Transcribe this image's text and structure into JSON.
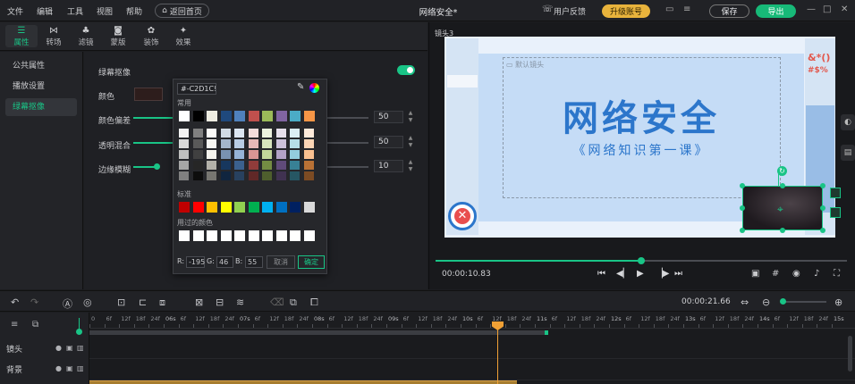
{
  "menubar": {
    "menus": [
      "文件",
      "编辑",
      "工具",
      "视图",
      "帮助"
    ],
    "home_button": "返回首页",
    "document_title": "网络安全*",
    "feedback": "用户反馈",
    "upgrade": "升级账号",
    "save": "保存",
    "export": "导出"
  },
  "tabs": [
    {
      "label": "属性",
      "icon": "sliders-icon",
      "active": true
    },
    {
      "label": "转场",
      "icon": "transition-icon"
    },
    {
      "label": "滤镜",
      "icon": "filter-icon"
    },
    {
      "label": "蒙版",
      "icon": "mask-icon"
    },
    {
      "label": "装饰",
      "icon": "decoration-icon"
    },
    {
      "label": "效果",
      "icon": "sparkle-icon"
    }
  ],
  "sidebar": {
    "items": [
      {
        "label": "公共属性"
      },
      {
        "label": "播放设置"
      },
      {
        "label": "绿幕抠像",
        "active": true
      }
    ]
  },
  "props": {
    "section_label": "绿幕抠像",
    "color_label": "颜色",
    "hue_label": "颜色偏差",
    "blend_label": "透明混合",
    "edge_label": "边缘模糊",
    "hue_value": "50",
    "blend_value": "50",
    "edge_value": "10",
    "enabled": true,
    "key_color": "#2d1d1c"
  },
  "picker": {
    "hex": "#-C2D1C!",
    "common_label": "常用",
    "standard_label": "标准",
    "recent_label": "用过的颜色",
    "r_label": "R:",
    "g_label": "G:",
    "b_label": "B:",
    "r": "-195",
    "g": "46",
    "b": "55",
    "cancel": "取消",
    "ok": "确定",
    "common_colors": [
      "#ffffff",
      "#000000",
      "#eeece1",
      "#1f497d",
      "#4f81bd",
      "#c0504d",
      "#9bbb59",
      "#8064a2",
      "#4bacc6",
      "#f79646"
    ],
    "standard_colors": [
      "#c00000",
      "#ff0000",
      "#ffc000",
      "#ffff00",
      "#92d050",
      "#00b050",
      "#00b0f0",
      "#0070c0",
      "#002060",
      "#d9d9d9"
    ],
    "recent_colors": [
      "#ffffff",
      "#ffffff",
      "#ffffff",
      "#ffffff",
      "#ffffff",
      "#ffffff",
      "#ffffff",
      "#ffffff",
      "#ffffff",
      "#ffffff"
    ]
  },
  "preview": {
    "camera_label": "镜头3",
    "default_camera": "默认镜头",
    "title_text": "网络安全",
    "subtitle_text": "《网络知识第一课》",
    "current_time": "00:00:10.83",
    "progress": 0.5
  },
  "timeline": {
    "duration": "00:00:21.66",
    "ruler_labels": [
      "0",
      "6f",
      "12f",
      "18f",
      "24f",
      "06s",
      "6f",
      "12f",
      "18f",
      "24f",
      "07s",
      "6f",
      "12f",
      "18f",
      "24f",
      "08s",
      "6f",
      "12f",
      "18f",
      "24f",
      "09s",
      "6f",
      "12f",
      "18f",
      "24f",
      "10s",
      "6f",
      "12f",
      "18f",
      "24f",
      "11s",
      "6f",
      "12f",
      "18f",
      "24f",
      "12s",
      "6f",
      "12f",
      "18f",
      "24f",
      "13s",
      "6f",
      "12f",
      "18f",
      "24f",
      "14s",
      "6f",
      "12f",
      "18f",
      "24f",
      "15s"
    ],
    "tracks": [
      {
        "label": "镜头"
      },
      {
        "label": "背景"
      }
    ]
  }
}
